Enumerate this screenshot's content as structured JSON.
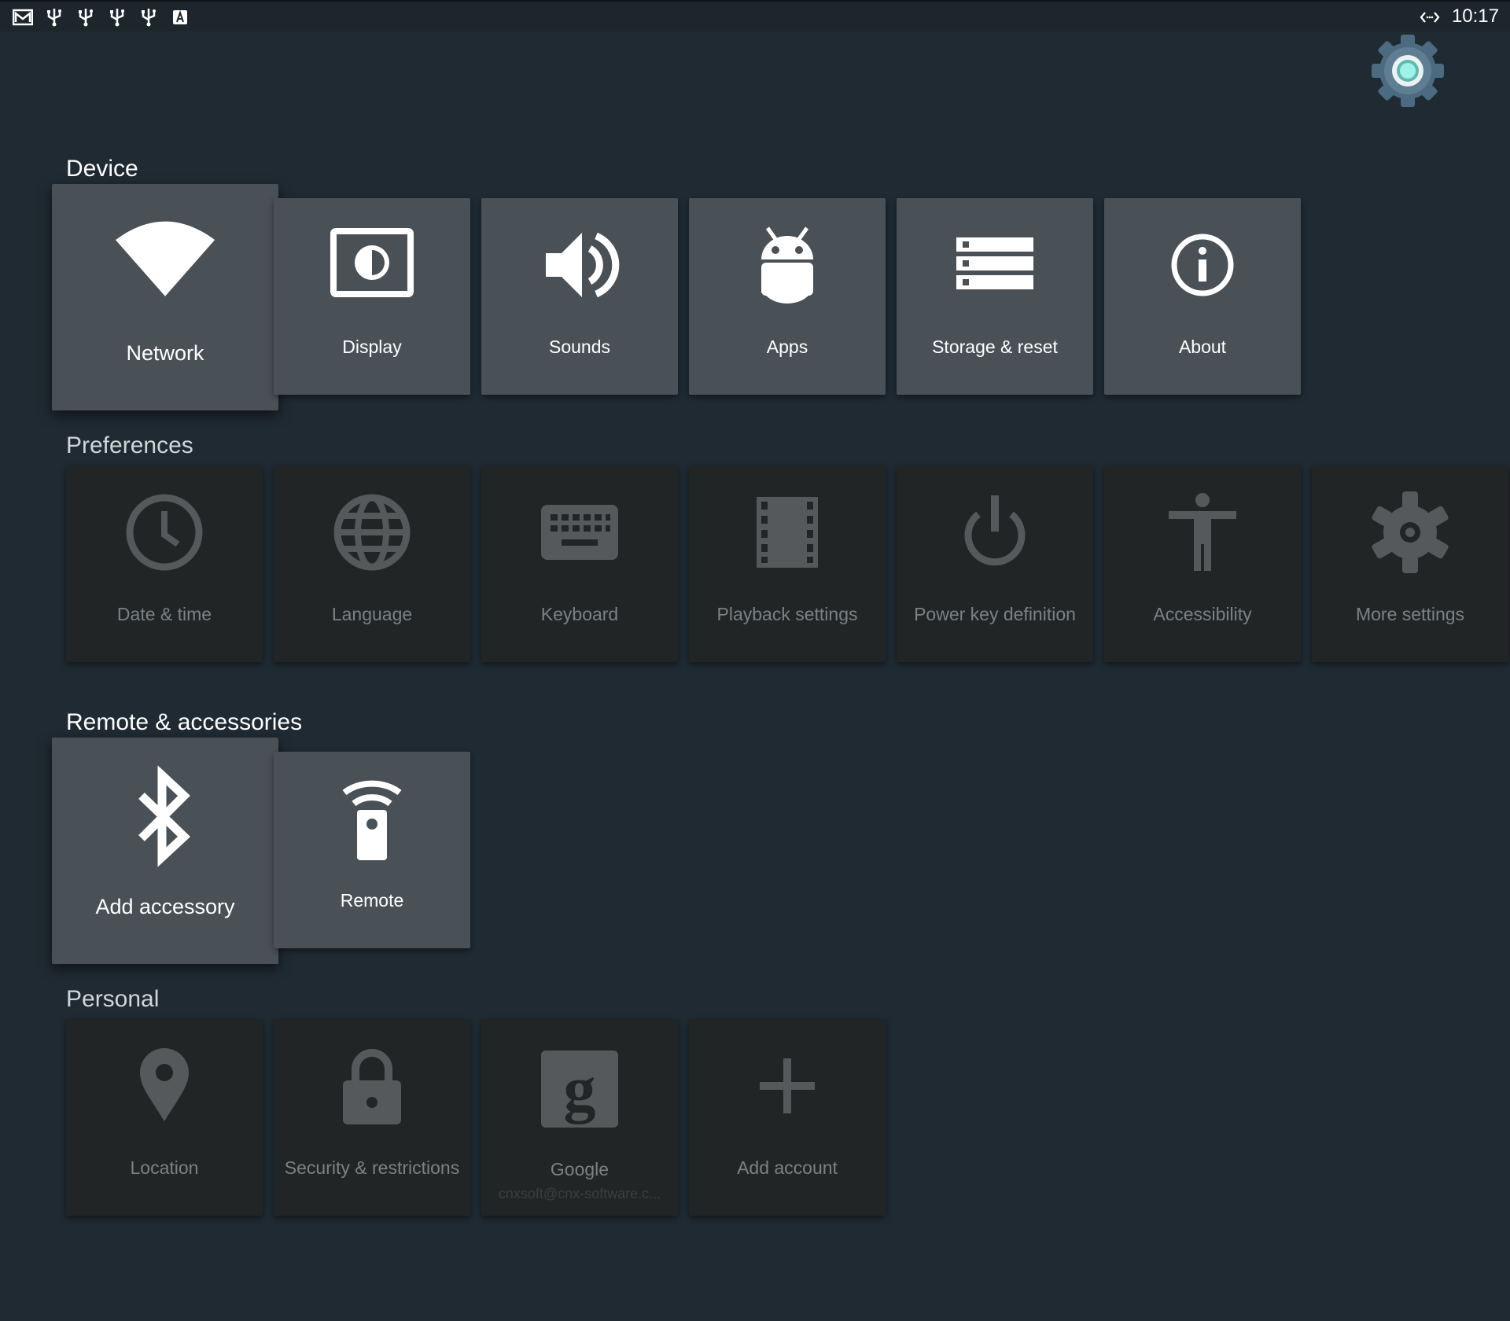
{
  "status_bar": {
    "clock": "10:17",
    "icons": [
      "mail-icon",
      "usb-icon",
      "usb-icon",
      "usb-icon",
      "usb-icon",
      "keyboard-a-icon"
    ],
    "sync_icon": "code-arrows-icon"
  },
  "app_logo": "settings-app-gear-icon",
  "colors": {
    "background": "#1f2a32",
    "tile_active": "#4a5156",
    "tile_dim": "#222526",
    "accent": "#7fe0d8"
  },
  "sections": {
    "device": {
      "title": "Device",
      "items": [
        {
          "label": "Network",
          "icon": "wifi-icon"
        },
        {
          "label": "Display",
          "icon": "display-icon"
        },
        {
          "label": "Sounds",
          "icon": "volume-icon"
        },
        {
          "label": "Apps",
          "icon": "android-icon"
        },
        {
          "label": "Storage & reset",
          "icon": "storage-icon"
        },
        {
          "label": "About",
          "icon": "info-icon"
        }
      ]
    },
    "preferences": {
      "title": "Preferences",
      "items": [
        {
          "label": "Date & time",
          "icon": "clock-icon"
        },
        {
          "label": "Language",
          "icon": "globe-icon"
        },
        {
          "label": "Keyboard",
          "icon": "keyboard-icon"
        },
        {
          "label": "Playback settings",
          "icon": "film-icon"
        },
        {
          "label": "Power key definition",
          "icon": "power-icon"
        },
        {
          "label": "Accessibility",
          "icon": "accessibility-icon"
        },
        {
          "label": "More settings",
          "icon": "gear-icon"
        }
      ]
    },
    "remote": {
      "title": "Remote & accessories",
      "items": [
        {
          "label": "Add accessory",
          "icon": "bluetooth-icon"
        },
        {
          "label": "Remote",
          "icon": "remote-icon"
        }
      ]
    },
    "personal": {
      "title": "Personal",
      "items": [
        {
          "label": "Location",
          "icon": "location-pin-icon"
        },
        {
          "label": "Security & restrictions",
          "icon": "lock-icon"
        },
        {
          "label": "Google",
          "sublabel": "cnxsoft@cnx-software.c...",
          "icon": "google-icon"
        },
        {
          "label": "Add account",
          "icon": "plus-icon"
        }
      ]
    }
  }
}
